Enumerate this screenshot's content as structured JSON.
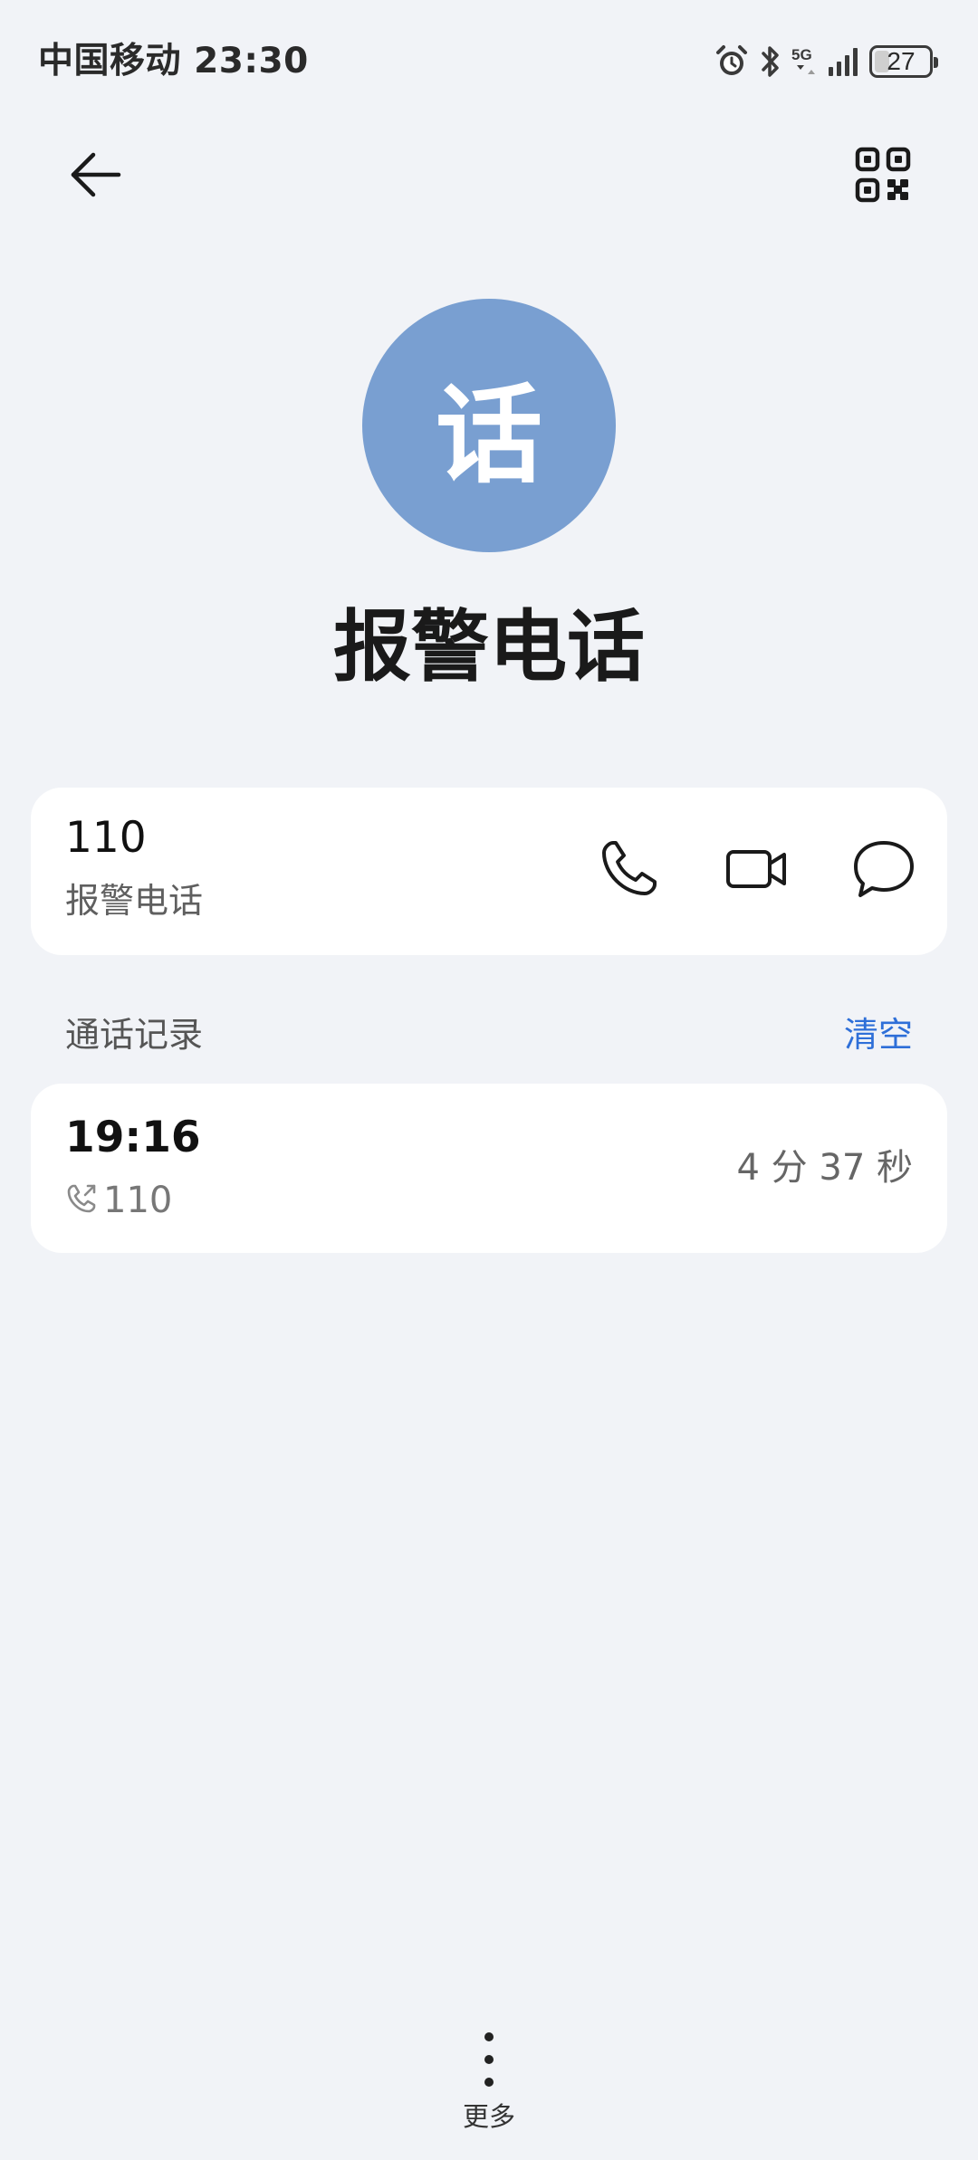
{
  "status_bar": {
    "carrier_time": "中国移动 23:30",
    "network": "5G",
    "battery": "27",
    "battery_fraction": 0.27,
    "icons": [
      "alarm-icon",
      "bluetooth-icon",
      "5g-icon",
      "signal-icon",
      "battery-icon"
    ]
  },
  "header": {
    "back_icon": "back-arrow-icon",
    "qr_icon": "qr-code-icon",
    "avatar_text": "话",
    "avatar_color": "#799fd1",
    "name": "报警电话"
  },
  "number_card": {
    "number": "110",
    "label": "报警电话",
    "actions": [
      "phone-icon",
      "video-call-icon",
      "message-icon"
    ]
  },
  "call_log": {
    "title": "通话记录",
    "clear_label": "清空",
    "accent_color": "#2e6fd8",
    "entries": [
      {
        "time": "19:16",
        "number": "110",
        "direction_icon": "outgoing-call-icon",
        "duration": "4 分 37 秒"
      }
    ]
  },
  "footer": {
    "more_label": "更多",
    "more_icon": "more-vertical-icon"
  }
}
